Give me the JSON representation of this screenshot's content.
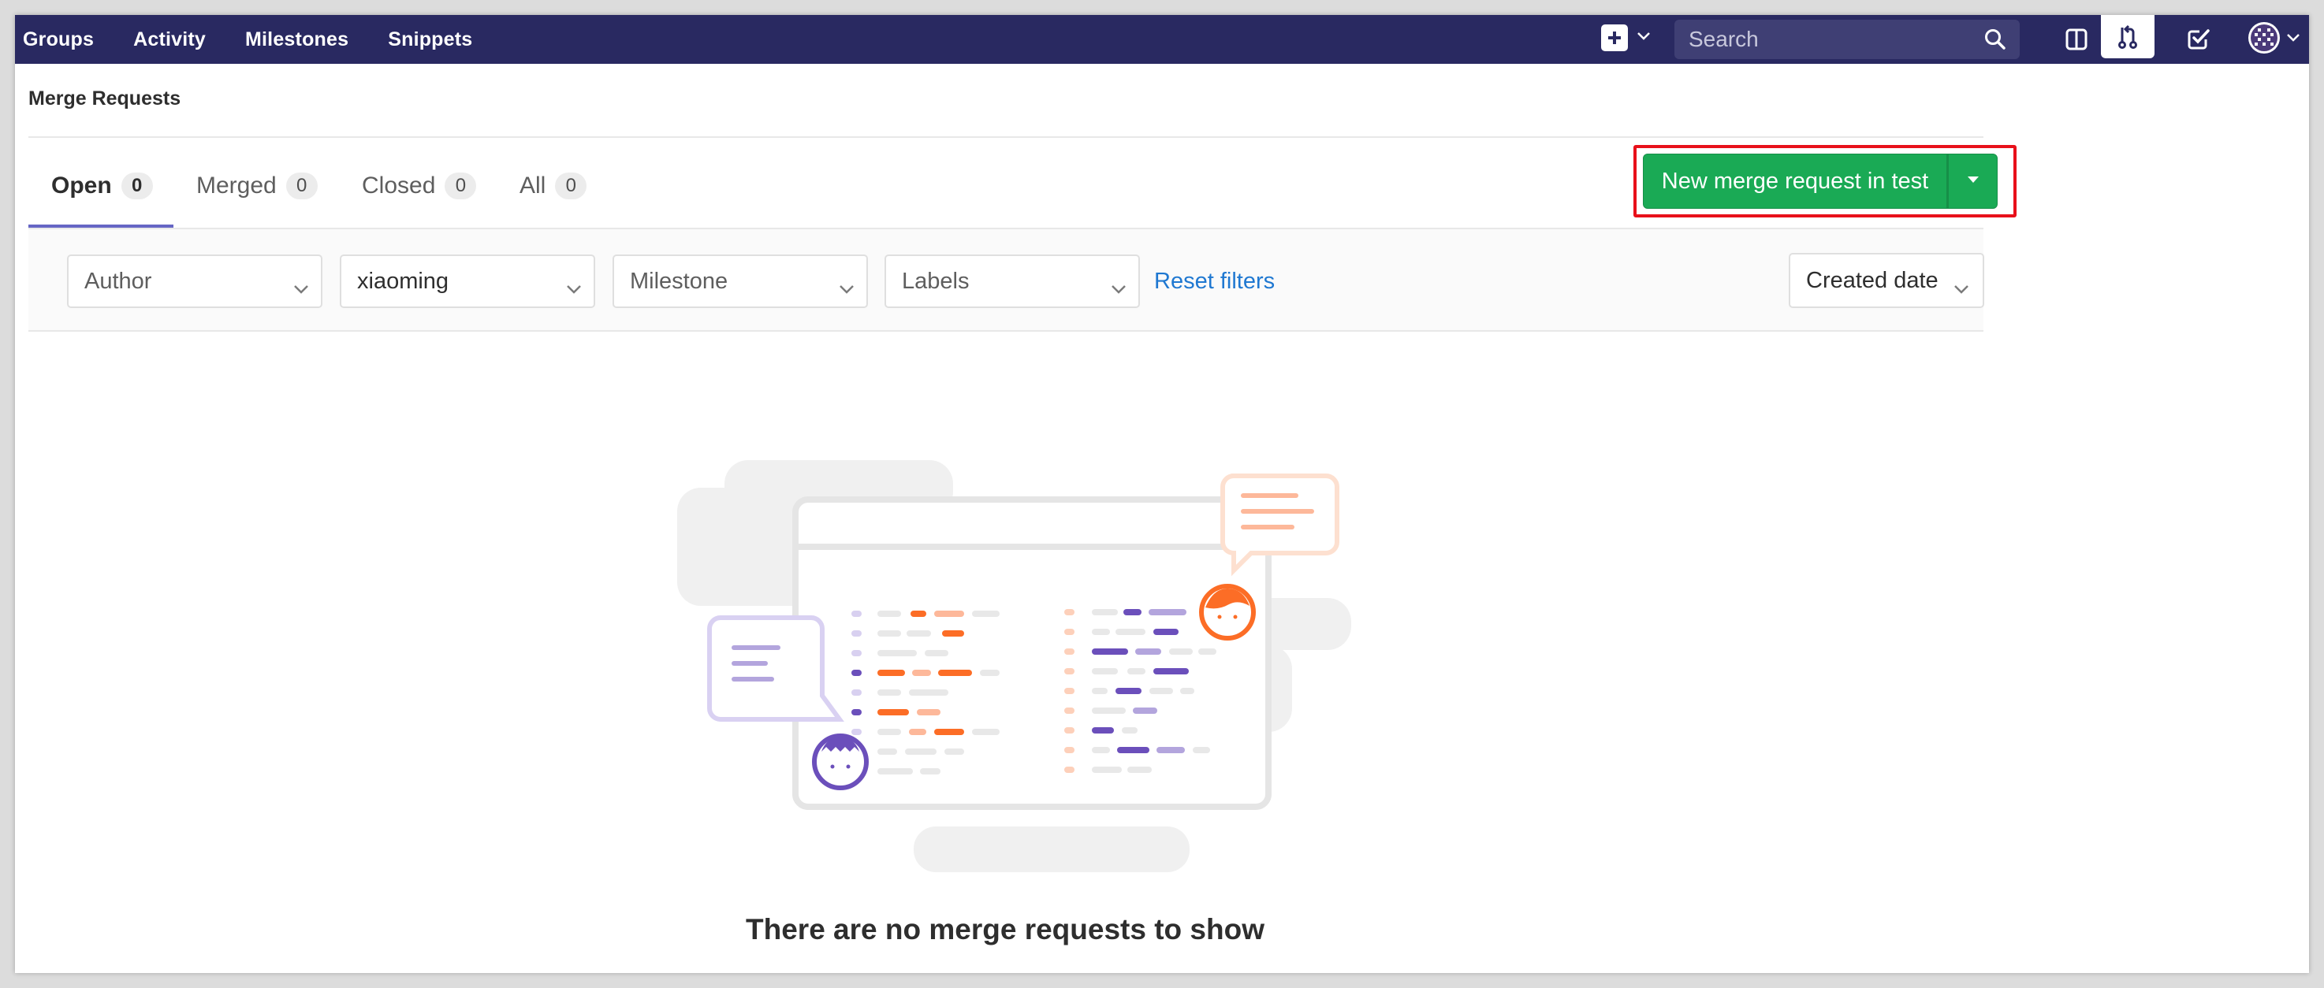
{
  "navbar": {
    "links": [
      "Groups",
      "Activity",
      "Milestones",
      "Snippets"
    ],
    "search_placeholder": "Search"
  },
  "page": {
    "title": "Merge Requests"
  },
  "tabs": [
    {
      "label": "Open",
      "count": "0"
    },
    {
      "label": "Merged",
      "count": "0"
    },
    {
      "label": "Closed",
      "count": "0"
    },
    {
      "label": "All",
      "count": "0"
    }
  ],
  "actions": {
    "new_mr_label": "New merge request in test"
  },
  "filters": {
    "author": "Author",
    "assignee": "xiaoming",
    "milestone": "Milestone",
    "labels": "Labels",
    "reset": "Reset filters",
    "sort": "Created date"
  },
  "empty_state": {
    "message": "There are no merge requests to show"
  },
  "colors": {
    "navbar": "#292961",
    "primary_button": "#1aaa55",
    "link": "#1f78d1",
    "highlight": "#e8101a",
    "tab_active": "#6666c4",
    "illustration_orange": "#fc6d26",
    "illustration_purple": "#6b4fbb"
  },
  "icons": [
    "plus-square-icon",
    "chevron-down-icon",
    "search-icon",
    "sidebar-icon",
    "merge-request-icon",
    "todo-check-icon",
    "user-avatar-icon",
    "caret-down-icon"
  ]
}
